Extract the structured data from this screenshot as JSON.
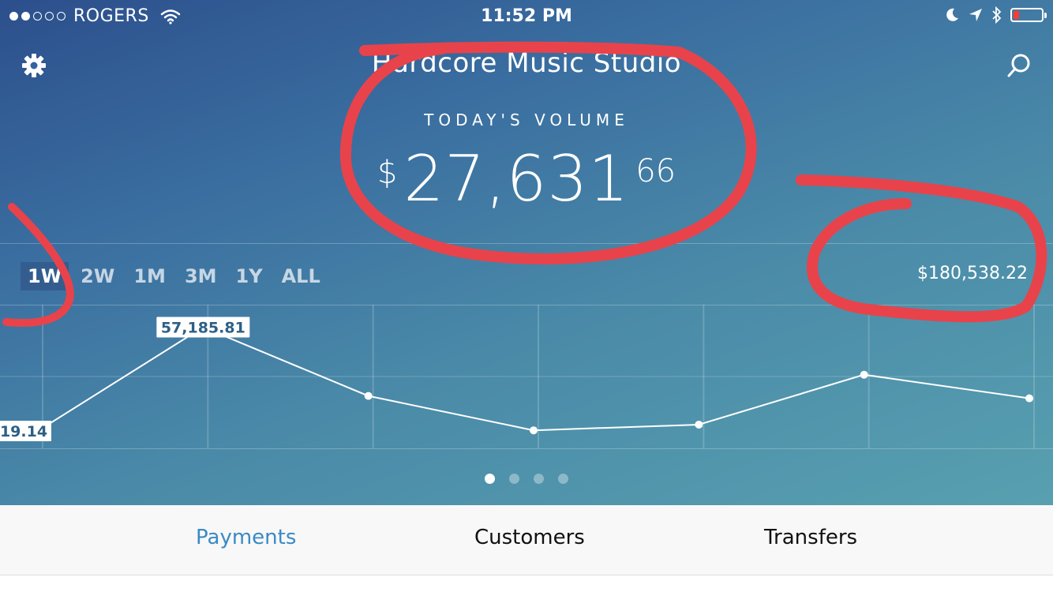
{
  "status_bar": {
    "carrier": "ROGERS",
    "time": "11:52 PM"
  },
  "header": {
    "title": "Hardcore Music Studio",
    "volume_label": "TODAY'S VOLUME",
    "volume_currency": "$",
    "volume_main": "27,631",
    "volume_cents": "66"
  },
  "ranges": [
    "1W",
    "2W",
    "1M",
    "3M",
    "1Y",
    "ALL"
  ],
  "active_range": "1W",
  "total": "$180,538.22",
  "chart_data": {
    "type": "line",
    "point_count": 7,
    "values": [
      19.14,
      57185.81,
      19300,
      350,
      3500,
      31000,
      18000
    ],
    "labels": {
      "first": "19.14",
      "max": "57,185.81"
    },
    "ylim": [
      0,
      60000
    ],
    "grid": true
  },
  "pager": {
    "count": 4,
    "active": 0
  },
  "tabs": [
    {
      "label": "Payments",
      "active": true
    },
    {
      "label": "Customers",
      "active": false
    },
    {
      "label": "Transfers",
      "active": false
    }
  ],
  "colors": {
    "accent": "#3b8ac4",
    "annotation": "#e8434b",
    "battery_low": "#ff3b30"
  },
  "icons": [
    "gear-icon",
    "search-icon",
    "wifi-icon",
    "moon-icon",
    "location-icon",
    "bluetooth-icon",
    "battery-icon"
  ]
}
